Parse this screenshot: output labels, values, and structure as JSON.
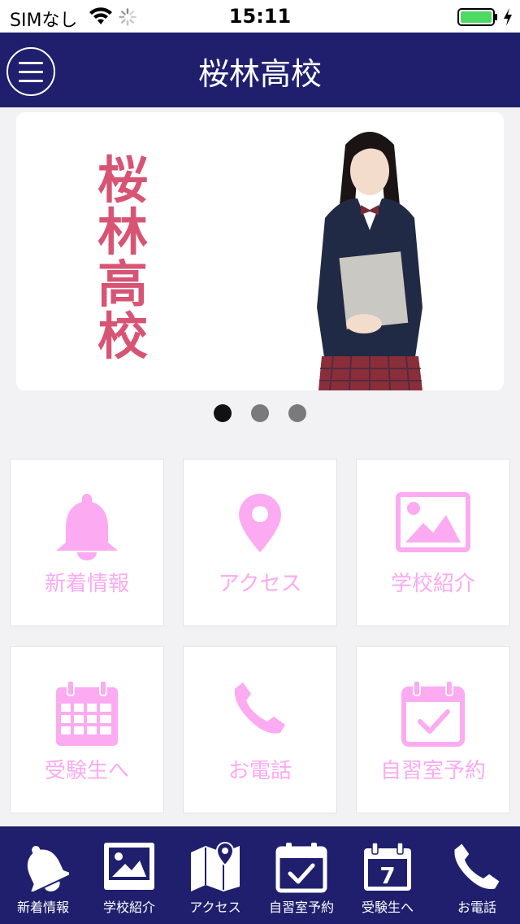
{
  "status_bar": {
    "carrier": "SIMなし",
    "time": "15:11",
    "wifi_icon": "wifi-icon",
    "spinner_icon": "activity-spinner-icon",
    "battery_icon": "battery-icon",
    "battery_color": "#4cd964"
  },
  "nav": {
    "title": "桜林高校",
    "menu_icon": "hamburger-menu-icon"
  },
  "banner": {
    "calligraphy": [
      "桜",
      "林",
      "高",
      "校"
    ],
    "calligraphy_color": "#d85474",
    "image_subject": "student-photo"
  },
  "carousel": {
    "slide_count": 3,
    "active_index": 0,
    "active_color": "#111111",
    "inactive_color": "#7a7a7a"
  },
  "tiles": [
    {
      "label": "新着情報",
      "icon": "bell-icon"
    },
    {
      "label": "アクセス",
      "icon": "map-pin-icon"
    },
    {
      "label": "学校紹介",
      "icon": "image-icon"
    },
    {
      "label": "受験生へ",
      "icon": "calendar-grid-icon"
    },
    {
      "label": "お電話",
      "icon": "phone-icon"
    },
    {
      "label": "自習室予約",
      "icon": "calendar-check-icon"
    }
  ],
  "tab_bar": {
    "items": [
      {
        "label": "新着情報",
        "icon": "bell-icon"
      },
      {
        "label": "学校紹介",
        "icon": "image-icon"
      },
      {
        "label": "アクセス",
        "icon": "map-icon"
      },
      {
        "label": "自習室予約",
        "icon": "calendar-check-icon"
      },
      {
        "label": "受験生へ",
        "icon": "calendar-7-icon"
      },
      {
        "label": "お電話",
        "icon": "phone-icon"
      }
    ],
    "calendar_day": "7"
  },
  "colors": {
    "nav_background": "#1f1f6e",
    "tile_accent": "#fcaaf2",
    "page_background": "#f2f2f5"
  }
}
